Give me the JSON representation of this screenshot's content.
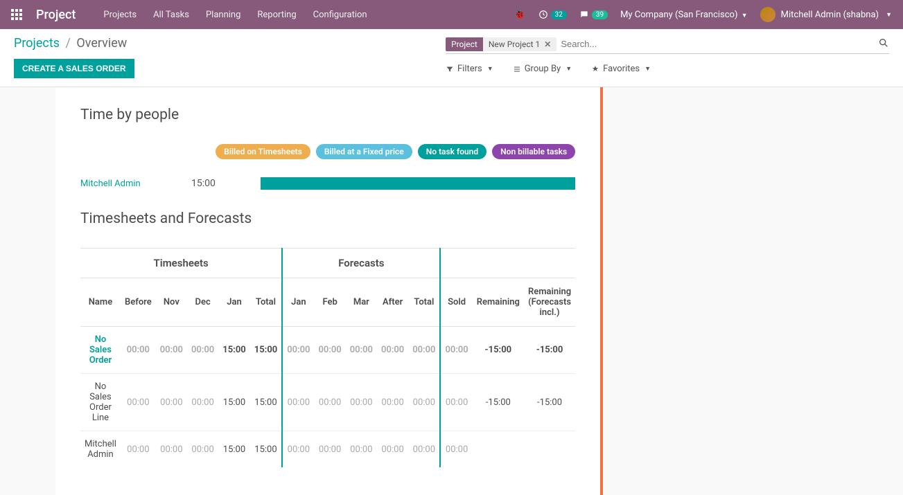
{
  "topnav": {
    "brand": "Project",
    "menu": [
      "Projects",
      "All Tasks",
      "Planning",
      "Reporting",
      "Configuration"
    ],
    "timer_badge": "32",
    "chat_badge": "39",
    "company": "My Company (San Francisco)",
    "user": "Mitchell Admin (shabna)"
  },
  "breadcrumb": {
    "root": "Projects",
    "current": "Overview"
  },
  "buttons": {
    "create_so": "CREATE A SALES ORDER"
  },
  "search": {
    "facet_label": "Project",
    "facet_value": "New Project 1",
    "placeholder": "Search...",
    "filters": "Filters",
    "groupby": "Group By",
    "favorites": "Favorites"
  },
  "section1": {
    "title": "Time by people",
    "legend": [
      "Billed on Timesheets",
      "Billed at a Fixed price",
      "No task found",
      "Non billable tasks"
    ],
    "person": "Mitchell Admin",
    "time": "15:00"
  },
  "section2": {
    "title": "Timesheets and Forecasts",
    "groups": [
      "Timesheets",
      "Forecasts",
      ""
    ],
    "headers": [
      "Name",
      "Before",
      "Nov",
      "Dec",
      "Jan",
      "Total",
      "Jan",
      "Feb",
      "Mar",
      "After",
      "Total",
      "Sold",
      "Remaining",
      "Remaining (Forecasts incl.)"
    ],
    "rows": [
      {
        "name": "No Sales Order",
        "cells": [
          "00:00",
          "00:00",
          "00:00",
          "15:00",
          "15:00",
          "00:00",
          "00:00",
          "00:00",
          "00:00",
          "00:00",
          "00:00",
          "-15:00",
          "-15:00"
        ],
        "head": true
      },
      {
        "name": "No Sales Order Line",
        "cells": [
          "00:00",
          "00:00",
          "00:00",
          "15:00",
          "15:00",
          "00:00",
          "00:00",
          "00:00",
          "00:00",
          "00:00",
          "00:00",
          "-15:00",
          "-15:00"
        ],
        "head": false
      },
      {
        "name": "Mitchell Admin",
        "cells": [
          "00:00",
          "00:00",
          "00:00",
          "15:00",
          "15:00",
          "00:00",
          "00:00",
          "00:00",
          "00:00",
          "00:00",
          "00:00",
          "",
          ""
        ],
        "head": false
      }
    ]
  },
  "chart_data": {
    "type": "bar",
    "orientation": "horizontal",
    "categories": [
      "Mitchell Admin"
    ],
    "series": [
      {
        "name": "Billed on Timesheets",
        "values": [
          0
        ]
      },
      {
        "name": "Billed at a Fixed price",
        "values": [
          0
        ]
      },
      {
        "name": "No task found",
        "values": [
          15
        ]
      },
      {
        "name": "Non billable tasks",
        "values": [
          0
        ]
      }
    ],
    "totals": [
      15
    ],
    "unit": "hours",
    "title": "Time by people",
    "legend_position": "top-right"
  }
}
